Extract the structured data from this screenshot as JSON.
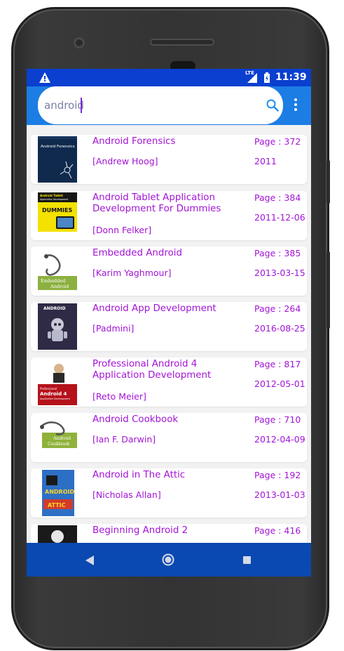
{
  "status_bar": {
    "network": "LTE",
    "time": "11:39"
  },
  "search": {
    "value": "android",
    "placeholder": ""
  },
  "colors": {
    "status_bar": "#0a3fcf",
    "app_bar": "#1c7de4",
    "nav_bar": "#0a49b1",
    "text_accent": "#a314d6"
  },
  "books": [
    {
      "title": "Android Forensics",
      "author": "[Andrew Hoog]",
      "pages": "Page : 372",
      "date": "2011",
      "cover_text": "Android Forensics"
    },
    {
      "title": "Android Tablet Application Development For Dummies",
      "author": "[Donn Felker]",
      "pages": "Page : 384",
      "date": "2011-12-06",
      "cover_text": "Android Tablet Application Development"
    },
    {
      "title": "Embedded Android",
      "author": "[Karim Yaghmour]",
      "pages": "Page : 385",
      "date": "2013-03-15",
      "cover_text": "Embedded Android"
    },
    {
      "title": "Android App Development",
      "author": "[Padmini]",
      "pages": "Page : 264",
      "date": "2016-08-25",
      "cover_text": "ANDROID"
    },
    {
      "title": "Professional Android 4 Application Development",
      "author": "[Reto Meier]",
      "pages": "Page : 817",
      "date": "2012-05-01",
      "cover_text": "Android 4"
    },
    {
      "title": "Android Cookbook",
      "author": "[Ian F. Darwin]",
      "pages": "Page : 710",
      "date": "2012-04-09",
      "cover_text": "Android Cookbook"
    },
    {
      "title": "Android in The Attic",
      "author": "[Nicholas Allan]",
      "pages": "Page : 192",
      "date": "2013-01-03",
      "cover_text": "ANDROID ATTIC"
    },
    {
      "title": "Beginning Android 2",
      "author": "",
      "pages": "Page : 416",
      "date": "",
      "cover_text": ""
    }
  ]
}
